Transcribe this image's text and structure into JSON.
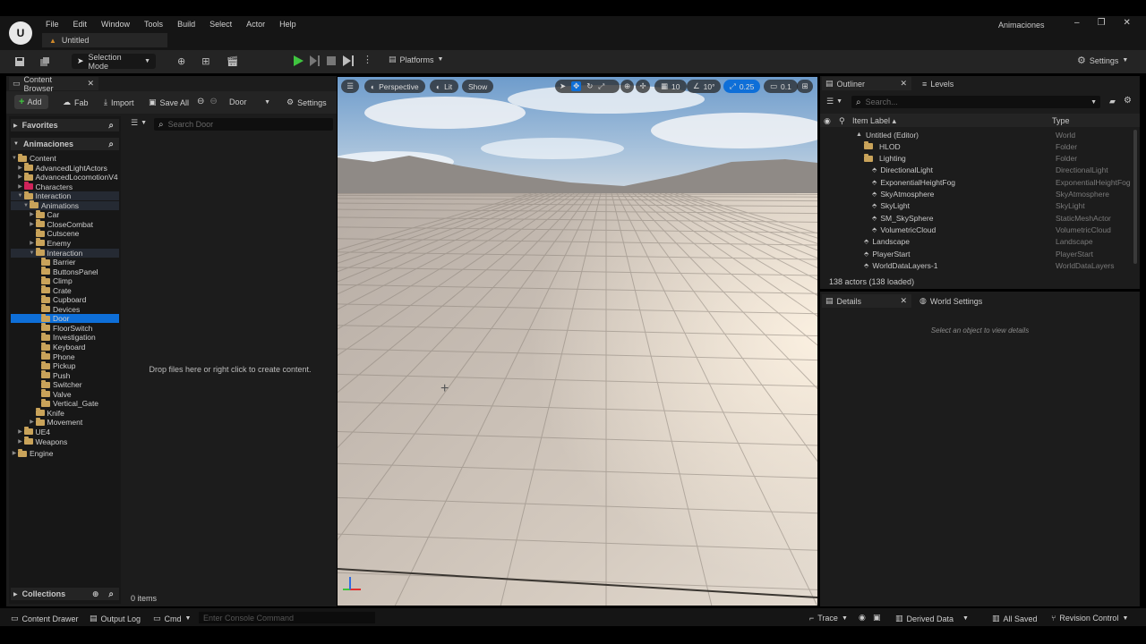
{
  "app": {
    "menu": [
      "File",
      "Edit",
      "Window",
      "Tools",
      "Build",
      "Select",
      "Actor",
      "Help"
    ],
    "project_name": "Animaciones",
    "level_tab": "Untitled"
  },
  "toolbar": {
    "mode": "Selection Mode",
    "platforms": "Platforms",
    "settings": "Settings"
  },
  "content_browser": {
    "tab_title": "Content Browser",
    "add": "Add",
    "fab": "Fab",
    "import": "Import",
    "save_all": "Save All",
    "path": "Door",
    "settings": "Settings",
    "favorites": "Favorites",
    "project_section": "Animaciones",
    "search_placeholder": "Search Door",
    "empty_message": "Drop files here or right click to create content.",
    "item_count": "0 items",
    "collections": "Collections",
    "tree": [
      {
        "label": "Content",
        "depth": 0,
        "open": true,
        "color": "tan"
      },
      {
        "label": "AdvancedLightActors",
        "depth": 1,
        "open": false,
        "color": "tan"
      },
      {
        "label": "AdvancedLocomotionV4",
        "depth": 1,
        "open": false,
        "color": "tan"
      },
      {
        "label": "Characters",
        "depth": 1,
        "open": false,
        "color": "pink"
      },
      {
        "label": "Interaction",
        "depth": 1,
        "open": true,
        "color": "tan"
      },
      {
        "label": "Animations",
        "depth": 2,
        "open": true,
        "color": "tan"
      },
      {
        "label": "Car",
        "depth": 3,
        "open": false,
        "color": "tan"
      },
      {
        "label": "CloseCombat",
        "depth": 3,
        "open": false,
        "color": "tan"
      },
      {
        "label": "Cutscene",
        "depth": 3,
        "open": null,
        "color": "tan"
      },
      {
        "label": "Enemy",
        "depth": 3,
        "open": false,
        "color": "tan"
      },
      {
        "label": "Interaction",
        "depth": 3,
        "open": true,
        "color": "tan"
      },
      {
        "label": "Barrier",
        "depth": 4,
        "open": null,
        "color": "tan"
      },
      {
        "label": "ButtonsPanel",
        "depth": 4,
        "open": null,
        "color": "tan"
      },
      {
        "label": "Climp",
        "depth": 4,
        "open": null,
        "color": "tan"
      },
      {
        "label": "Crate",
        "depth": 4,
        "open": null,
        "color": "tan"
      },
      {
        "label": "Cupboard",
        "depth": 4,
        "open": null,
        "color": "tan"
      },
      {
        "label": "Devices",
        "depth": 4,
        "open": null,
        "color": "tan"
      },
      {
        "label": "Door",
        "depth": 4,
        "open": null,
        "color": "tan",
        "selected": true
      },
      {
        "label": "FloorSwitch",
        "depth": 4,
        "open": null,
        "color": "tan"
      },
      {
        "label": "Investigation",
        "depth": 4,
        "open": null,
        "color": "tan"
      },
      {
        "label": "Keyboard",
        "depth": 4,
        "open": null,
        "color": "tan"
      },
      {
        "label": "Phone",
        "depth": 4,
        "open": null,
        "color": "tan"
      },
      {
        "label": "Pickup",
        "depth": 4,
        "open": null,
        "color": "tan"
      },
      {
        "label": "Push",
        "depth": 4,
        "open": null,
        "color": "tan"
      },
      {
        "label": "Switcher",
        "depth": 4,
        "open": null,
        "color": "tan"
      },
      {
        "label": "Valve",
        "depth": 4,
        "open": null,
        "color": "tan"
      },
      {
        "label": "Vertical_Gate",
        "depth": 4,
        "open": null,
        "color": "tan"
      },
      {
        "label": "Knife",
        "depth": 3,
        "open": null,
        "color": "tan"
      },
      {
        "label": "Movement",
        "depth": 3,
        "open": false,
        "color": "tan"
      },
      {
        "label": "UE4",
        "depth": 1,
        "open": false,
        "color": "tan"
      },
      {
        "label": "Weapons",
        "depth": 1,
        "open": false,
        "color": "tan"
      }
    ],
    "engine": "Engine"
  },
  "viewport": {
    "perspective": "Perspective",
    "lit": "Lit",
    "show": "Show",
    "grid_snap": "10",
    "rot_snap": "10°",
    "scale_snap": "0.25",
    "cam_speed": "0.1"
  },
  "outliner": {
    "tab_title": "Outliner",
    "levels_tab": "Levels",
    "search_placeholder": "Search...",
    "col_label": "Item Label ▴",
    "col_type": "Type",
    "rows": [
      {
        "label": "Untitled (Editor)",
        "type": "World",
        "indent": 0
      },
      {
        "label": "HLOD",
        "type": "Folder",
        "indent": 1
      },
      {
        "label": "Lighting",
        "type": "Folder",
        "indent": 1
      },
      {
        "label": "DirectionalLight",
        "type": "DirectionalLight",
        "indent": 2
      },
      {
        "label": "ExponentialHeightFog",
        "type": "ExponentialHeightFog",
        "indent": 2
      },
      {
        "label": "SkyAtmosphere",
        "type": "SkyAtmosphere",
        "indent": 2
      },
      {
        "label": "SkyLight",
        "type": "SkyLight",
        "indent": 2
      },
      {
        "label": "SM_SkySphere",
        "type": "StaticMeshActor",
        "indent": 2
      },
      {
        "label": "VolumetricCloud",
        "type": "VolumetricCloud",
        "indent": 2
      },
      {
        "label": "Landscape",
        "type": "Landscape",
        "indent": 1
      },
      {
        "label": "PlayerStart",
        "type": "PlayerStart",
        "indent": 1
      },
      {
        "label": "WorldDataLayers-1",
        "type": "WorldDataLayers",
        "indent": 1
      }
    ],
    "actor_count": "138 actors (138 loaded)"
  },
  "details": {
    "tab_title": "Details",
    "world_settings_tab": "World Settings",
    "empty_message": "Select an object to view details"
  },
  "statusbar": {
    "content_drawer": "Content Drawer",
    "output_log": "Output Log",
    "cmd": "Cmd",
    "console_placeholder": "Enter Console Command",
    "trace": "Trace",
    "derived_data": "Derived Data",
    "all_saved": "All Saved",
    "revision_control": "Revision Control"
  },
  "colors": {
    "accent_blue": "#0e6fd8",
    "play_green": "#3fc43f",
    "folder_tan": "#c9a35a",
    "folder_pink": "#d0245a"
  }
}
